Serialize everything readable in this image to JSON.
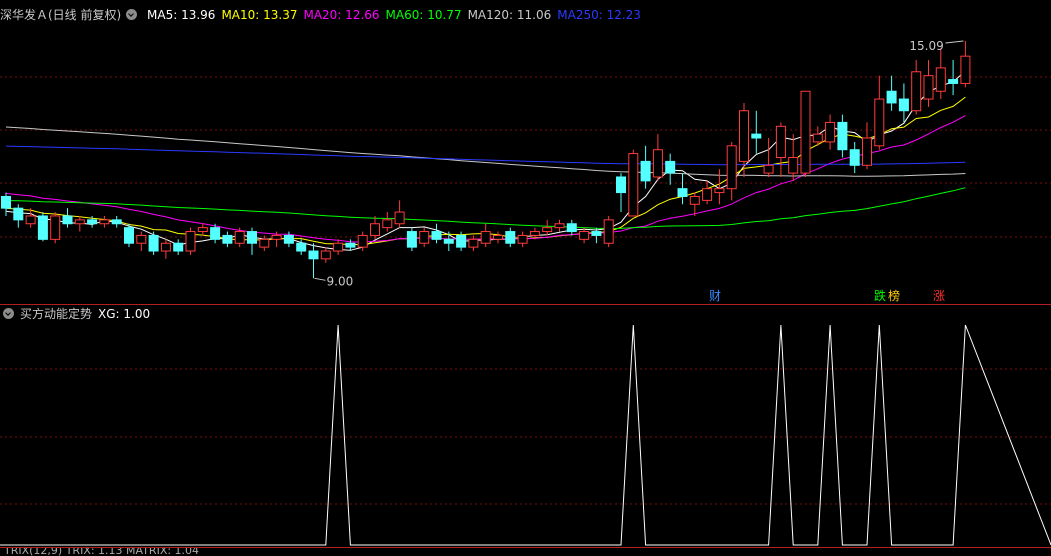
{
  "header": {
    "title": "深华发Ａ(日线 前复权)",
    "ma_labels": [
      {
        "text": "MA5: 13.96",
        "color": "#ffffff"
      },
      {
        "text": "MA10: 13.37",
        "color": "#ffff00"
      },
      {
        "text": "MA20: 12.66",
        "color": "#ff00ff"
      },
      {
        "text": "MA60: 10.77",
        "color": "#00ff00"
      },
      {
        "text": "MA120: 11.06",
        "color": "#c8c8c8"
      },
      {
        "text": "MA250: 12.23",
        "color": "#2a3aff"
      }
    ]
  },
  "price_chart": {
    "high_label": "15.09",
    "low_label": "9.00",
    "event_tags": [
      {
        "text": "财",
        "color": "#3a8aff"
      },
      {
        "text": "跌",
        "color": "#00ff00"
      },
      {
        "text": "榜",
        "color": "#ffcc00"
      },
      {
        "text": "涨",
        "color": "#ff3030"
      }
    ]
  },
  "indicator": {
    "title": "买方动能定势",
    "value_label": "XG: 1.00"
  },
  "bottom_bar": {
    "text": "TRIX(12,9) TRIX: 1.13 MATRIX: 1.04"
  },
  "colors": {
    "up": "#ff3b3b",
    "down": "#54ffff",
    "ma5": "#ffffff",
    "ma10": "#ffff00",
    "ma20": "#ff00ff",
    "ma60": "#00ff00",
    "ma120": "#c8c8c8",
    "ma250": "#2a3aff"
  },
  "chart_data": {
    "type": "candlestick",
    "y_range": [
      8.7,
      15.5
    ],
    "candles": [
      [
        11.1,
        10.8,
        11.2,
        10.6
      ],
      [
        10.8,
        10.5,
        10.9,
        10.3
      ],
      [
        10.4,
        10.6,
        10.8,
        10.3
      ],
      [
        10.6,
        10.0,
        10.7,
        9.95
      ],
      [
        10.0,
        10.6,
        10.7,
        9.9
      ],
      [
        10.6,
        10.4,
        10.8,
        10.3
      ],
      [
        10.4,
        10.5,
        10.6,
        10.2
      ],
      [
        10.5,
        10.4,
        10.6,
        10.3
      ],
      [
        10.4,
        10.5,
        10.6,
        10.3
      ],
      [
        10.5,
        10.4,
        10.6,
        10.3
      ],
      [
        10.3,
        9.9,
        10.4,
        9.8
      ],
      [
        9.9,
        10.1,
        10.2,
        9.7
      ],
      [
        10.1,
        9.7,
        10.2,
        9.6
      ],
      [
        9.7,
        9.9,
        10.0,
        9.5
      ],
      [
        9.9,
        9.7,
        10.0,
        9.6
      ],
      [
        9.7,
        10.2,
        10.3,
        9.6
      ],
      [
        10.2,
        10.3,
        10.4,
        10.1
      ],
      [
        10.3,
        10.0,
        10.4,
        9.9
      ],
      [
        10.1,
        9.9,
        10.2,
        9.8
      ],
      [
        9.9,
        10.2,
        10.3,
        9.8
      ],
      [
        10.2,
        9.9,
        10.3,
        9.6
      ],
      [
        9.8,
        10.0,
        10.1,
        9.7
      ],
      [
        10.0,
        10.1,
        10.2,
        9.8
      ],
      [
        10.1,
        9.9,
        10.2,
        9.8
      ],
      [
        9.9,
        9.7,
        10.0,
        9.6
      ],
      [
        9.7,
        9.5,
        9.9,
        9.0
      ],
      [
        9.5,
        9.7,
        9.8,
        9.4
      ],
      [
        9.7,
        9.9,
        10.0,
        9.6
      ],
      [
        9.9,
        9.8,
        10.0,
        9.7
      ],
      [
        9.8,
        10.1,
        10.2,
        9.7
      ],
      [
        10.1,
        10.4,
        10.6,
        10.0
      ],
      [
        10.3,
        10.5,
        10.7,
        10.2
      ],
      [
        10.4,
        10.7,
        11.0,
        10.3
      ],
      [
        10.2,
        9.8,
        10.3,
        9.7
      ],
      [
        9.9,
        10.2,
        10.3,
        9.8
      ],
      [
        10.2,
        10.0,
        10.4,
        9.9
      ],
      [
        10.0,
        9.9,
        10.2,
        9.7
      ],
      [
        10.1,
        9.8,
        10.2,
        9.7
      ],
      [
        9.8,
        10.0,
        10.1,
        9.7
      ],
      [
        9.9,
        10.2,
        10.4,
        9.8
      ],
      [
        10.0,
        10.1,
        10.2,
        9.9
      ],
      [
        10.2,
        9.9,
        10.3,
        9.8
      ],
      [
        9.9,
        10.1,
        10.2,
        9.8
      ],
      [
        10.1,
        10.2,
        10.3,
        10.0
      ],
      [
        10.2,
        10.3,
        10.5,
        10.1
      ],
      [
        10.3,
        10.4,
        10.5,
        10.2
      ],
      [
        10.4,
        10.2,
        10.5,
        10.1
      ],
      [
        10.0,
        10.2,
        10.3,
        9.9
      ],
      [
        10.2,
        10.1,
        10.3,
        9.9
      ],
      [
        9.9,
        10.5,
        10.6,
        9.8
      ],
      [
        11.6,
        11.2,
        11.7,
        10.7
      ],
      [
        10.6,
        12.2,
        12.3,
        10.6
      ],
      [
        12.0,
        11.5,
        12.4,
        11.3
      ],
      [
        11.6,
        12.3,
        12.7,
        11.5
      ],
      [
        12.0,
        11.7,
        12.2,
        11.4
      ],
      [
        11.3,
        11.1,
        11.7,
        10.9
      ],
      [
        10.9,
        11.1,
        11.2,
        10.6
      ],
      [
        11.0,
        11.3,
        11.5,
        10.9
      ],
      [
        11.2,
        11.3,
        11.8,
        10.9
      ],
      [
        11.3,
        12.4,
        12.5,
        11.0
      ],
      [
        12.0,
        13.3,
        13.5,
        11.6
      ],
      [
        12.7,
        12.6,
        13.3,
        12.2
      ],
      [
        11.7,
        11.9,
        12.6,
        11.6
      ],
      [
        12.1,
        12.9,
        13.0,
        11.6
      ],
      [
        11.7,
        12.1,
        12.7,
        11.5
      ],
      [
        11.7,
        13.8,
        13.8,
        11.6
      ],
      [
        12.5,
        12.7,
        12.9,
        12.4
      ],
      [
        12.5,
        13.0,
        13.2,
        12.3
      ],
      [
        13.0,
        12.3,
        13.2,
        12.1
      ],
      [
        12.3,
        11.9,
        12.5,
        11.7
      ],
      [
        11.9,
        12.6,
        13.0,
        11.8
      ],
      [
        12.4,
        13.6,
        14.2,
        12.3
      ],
      [
        13.8,
        13.5,
        14.2,
        13.3
      ],
      [
        13.6,
        13.3,
        14.0,
        13.0
      ],
      [
        13.3,
        14.3,
        14.6,
        13.2
      ],
      [
        13.6,
        14.2,
        14.6,
        13.4
      ],
      [
        13.8,
        14.4,
        14.9,
        13.6
      ],
      [
        14.1,
        14.0,
        14.6,
        13.7
      ],
      [
        14.0,
        14.7,
        15.09,
        13.9
      ]
    ],
    "indicator_spikes": [
      27,
      51,
      63,
      67,
      71,
      78
    ]
  }
}
